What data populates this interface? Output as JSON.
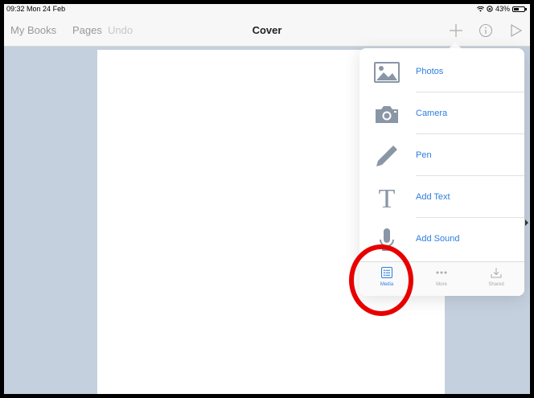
{
  "status": {
    "time": "09:32",
    "date": "Mon 24 Feb",
    "battery": "43%"
  },
  "nav": {
    "my_books": "My Books",
    "pages": "Pages",
    "undo": "Undo",
    "title": "Cover"
  },
  "menu": [
    {
      "label": "Photos",
      "icon": "photo-icon"
    },
    {
      "label": "Camera",
      "icon": "camera-icon"
    },
    {
      "label": "Pen",
      "icon": "pen-icon"
    },
    {
      "label": "Add Text",
      "icon": "text-icon"
    },
    {
      "label": "Add Sound",
      "icon": "microphone-icon"
    }
  ],
  "tabs": [
    {
      "label": "Media",
      "icon": "media-list-icon",
      "active": true
    },
    {
      "label": "More",
      "icon": "more-dots-icon",
      "active": false
    },
    {
      "label": "Shared",
      "icon": "download-icon",
      "active": false
    }
  ],
  "colors": {
    "accent": "#2d7de0",
    "icon_gray": "#8a96a6",
    "highlight": "#e80000"
  }
}
